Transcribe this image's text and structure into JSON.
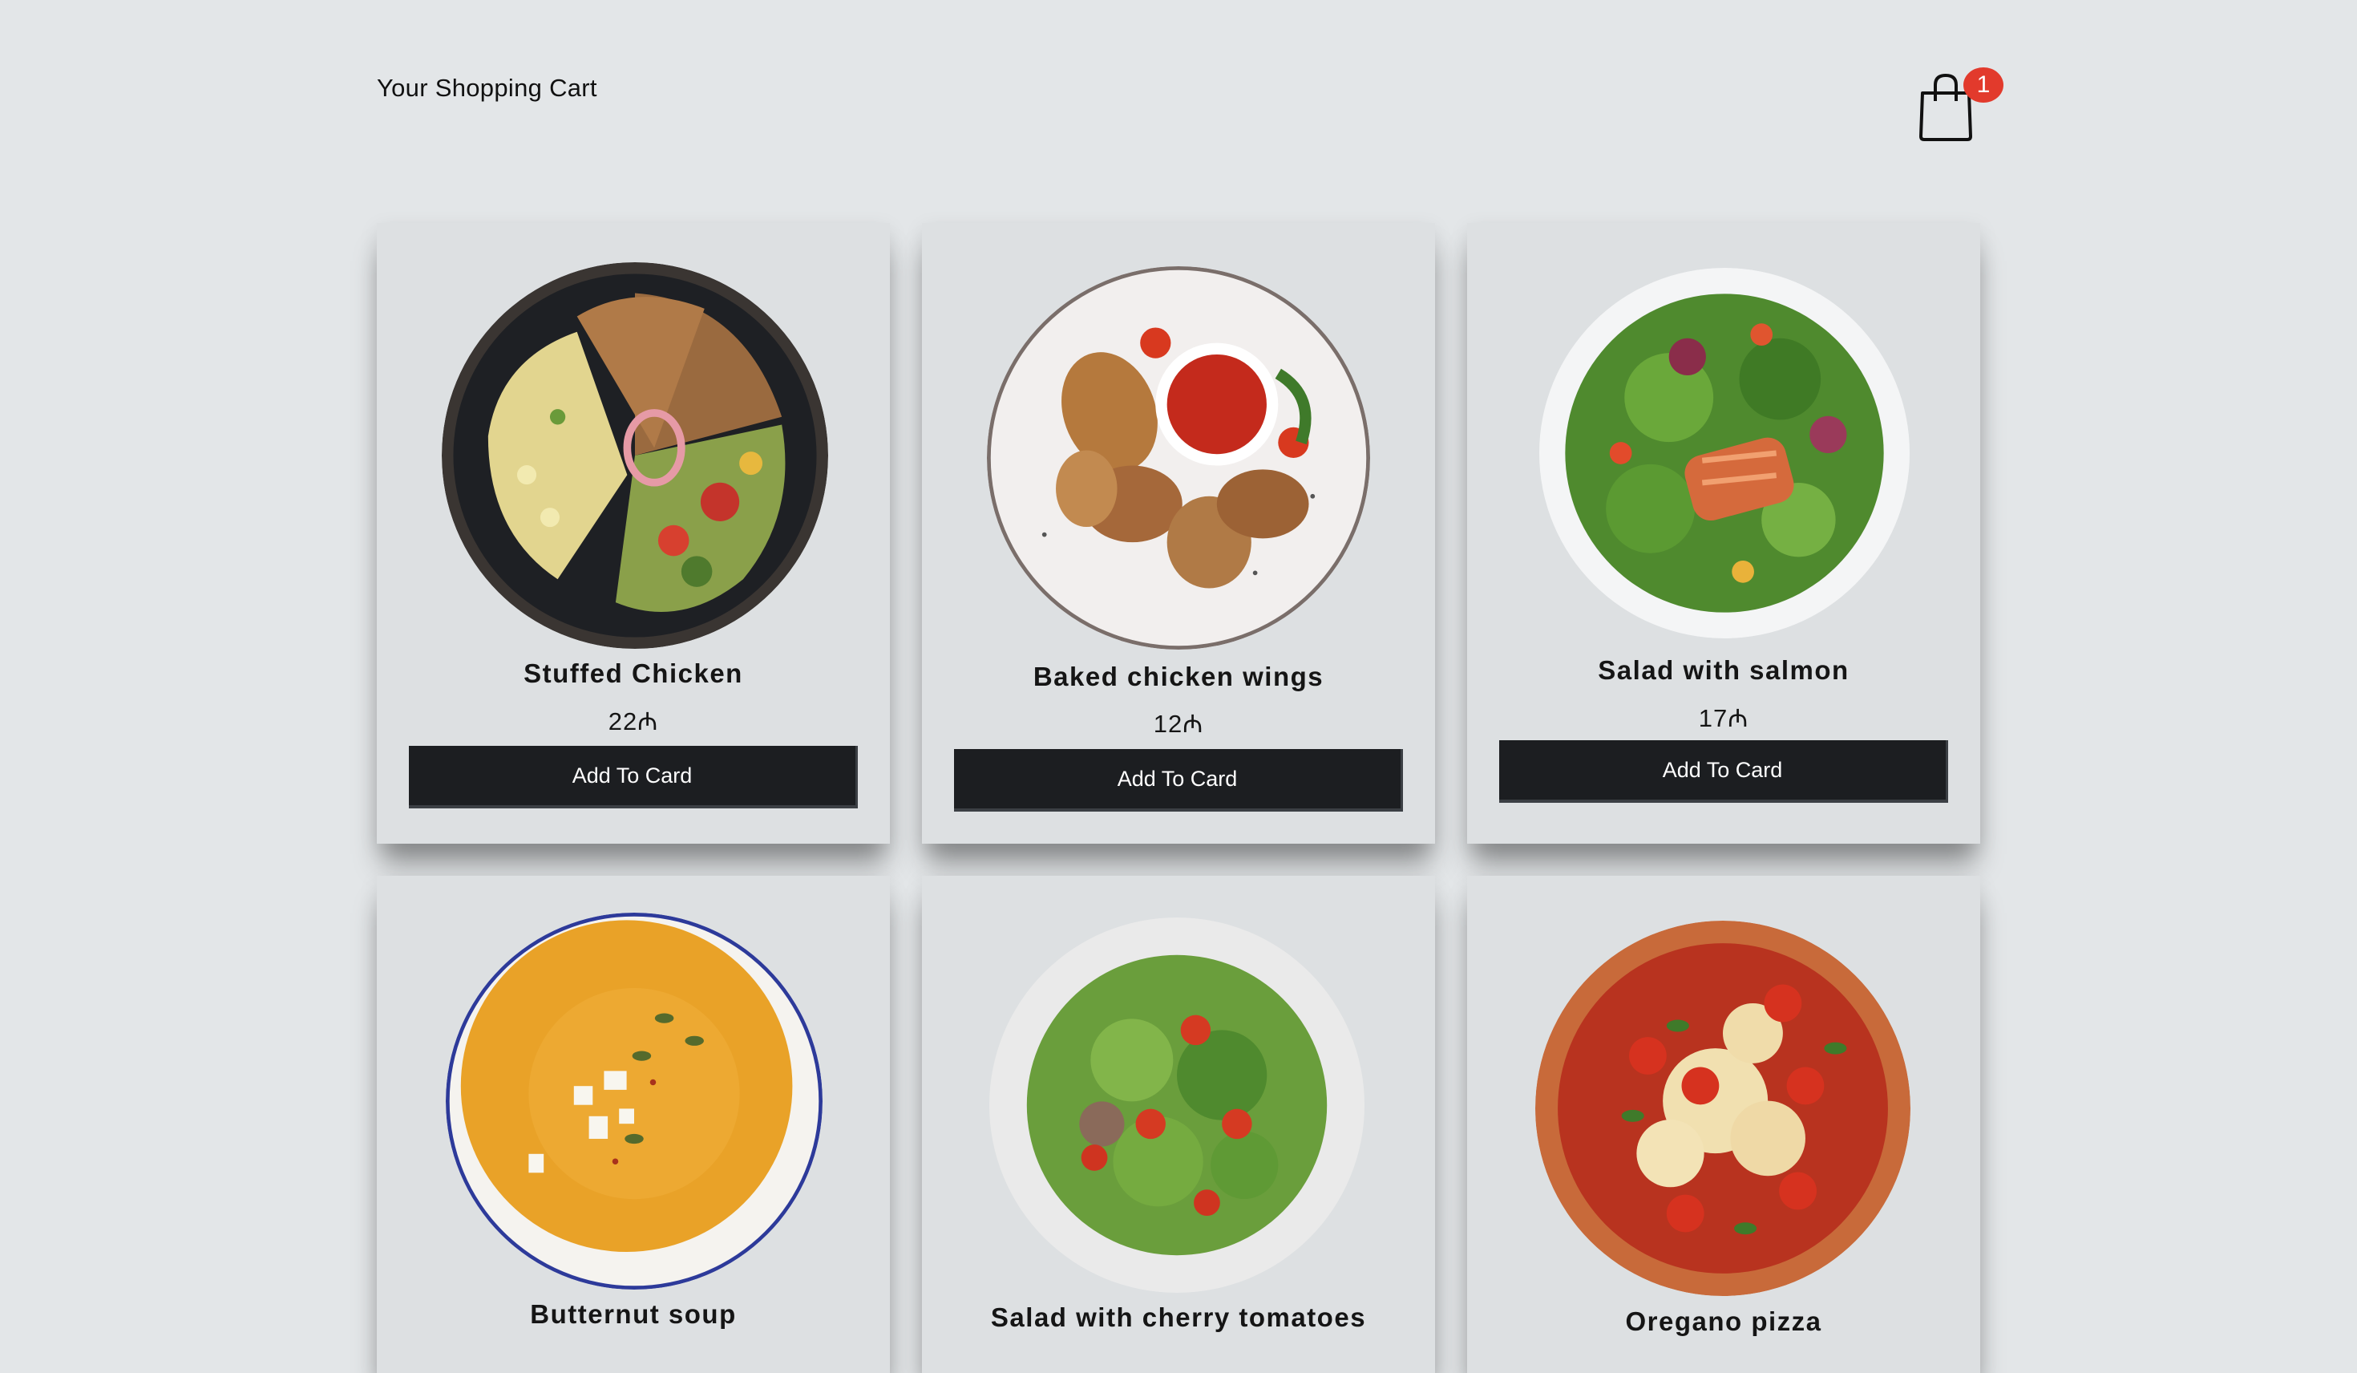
{
  "header": {
    "title": "Your Shopping Cart",
    "cart_icon": "shopping-bag-icon",
    "cart_count": "1"
  },
  "colors": {
    "background": "#e3e6e8",
    "card": "#dde0e2",
    "button": "#1c1e21",
    "badge": "#e23a2c"
  },
  "products": [
    {
      "name": "Stuffed Chicken",
      "price": "22₼",
      "button": "Add To Card"
    },
    {
      "name": "Baked chicken wings",
      "price": "12₼",
      "button": "Add To Card"
    },
    {
      "name": "Salad with salmon",
      "price": "17₼",
      "button": "Add To Card"
    },
    {
      "name": "Butternut soup"
    },
    {
      "name": "Salad with cherry tomatoes"
    },
    {
      "name": "Oregano pizza"
    }
  ]
}
